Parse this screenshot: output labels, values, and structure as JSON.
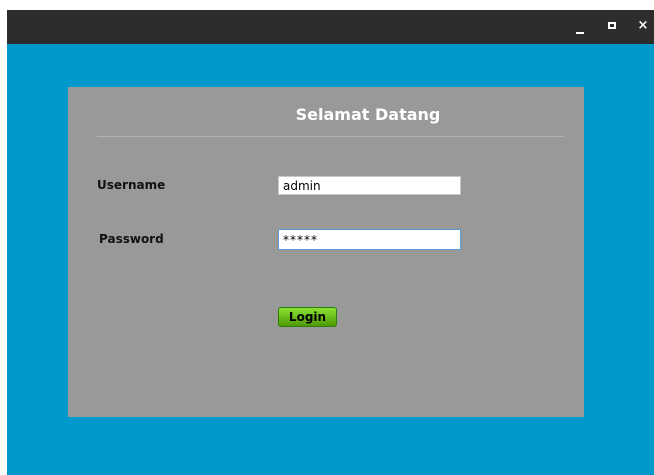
{
  "window": {
    "controls": {
      "minimize_icon": "minimize-icon",
      "maximize_icon": "maximize-icon",
      "close_label": "×"
    }
  },
  "login": {
    "title": "Selamat Datang",
    "username_label": "Username",
    "username_value": "admin",
    "password_label": "Password",
    "password_value": "*****",
    "login_button": "Login"
  },
  "colors": {
    "background": "#0099cc",
    "titlebar": "#2d2d2d",
    "panel": "#999999",
    "login_button": "#4e9a06"
  }
}
